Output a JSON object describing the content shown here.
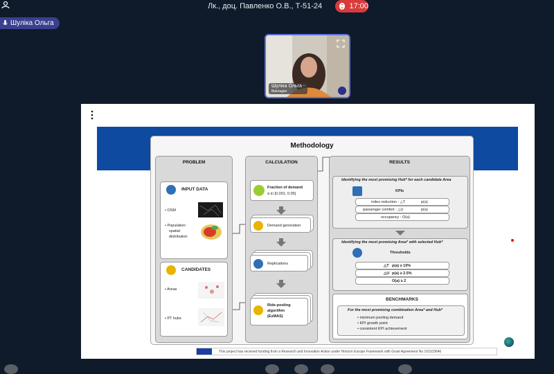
{
  "meeting": {
    "title": "Лк., доц. Павленко О.В., Т-51-24",
    "timer": "17:00",
    "self_name": "Шуліка Ольга"
  },
  "video": {
    "participant_label": "Шуліка Ольга -",
    "participant_sub": "Викладач"
  },
  "slide": {
    "title": "Methodology",
    "columns": {
      "problem": "PROBLEM",
      "calculation": "CALCULATION",
      "results": "RESULTS"
    },
    "problem": {
      "input_data": "INPUT DATA",
      "osm": "• OSM",
      "population": "• Population:",
      "spatial": "spatial",
      "distribution": "distribution",
      "candidates": "CANDIDATES",
      "areas": "• Areas",
      "pt_hubs": "• PT hubs"
    },
    "calculation": {
      "fraction": "Fraction of demand",
      "fraction_range": "α in [0.001, 0.05]",
      "demand_gen": "Demand generation",
      "replications": "Replications",
      "ridepool_1": "Ride-pooling",
      "ridepool_2": "algorithm",
      "ridepool_3": "(ExMAS)"
    },
    "results": {
      "q1": "Identifying the most promising Hub* for each candidate Area",
      "kpis": "KPIs",
      "k1": "miles reduction : △T",
      "k1s": "p(a)",
      "k2": "passenger comfort : △U",
      "k2s": "p(a)",
      "k3": "occupancy : O(a)",
      "q2": "Identifying the most promising Area* with selected Hub*",
      "thresholds": "Thresholds",
      "t1": "△T",
      "t1s": "p(a) ≥ 10%",
      "t2": "△U",
      "t2s": "p(a) ≥ 2.5%",
      "t3": "O(a) ≥ 2",
      "benchmarks": "BENCHMARKS",
      "b_head": "For the most promising combination Area* and Hub*",
      "b1": "• minimum pooling demand",
      "b2": "• KPI growth point",
      "b3": "• consistent KPI achievement"
    },
    "funding": "This project has received funding from a Research and Innovation Action under Horizon Europe Framework with Grant Agreement No 101103646"
  },
  "colors": {
    "background": "#0f1b2b",
    "record": "#d93a3a",
    "chip": "#3a3f8f",
    "slide_band": "#0d4aa0",
    "video_border": "#5c6fd8"
  }
}
